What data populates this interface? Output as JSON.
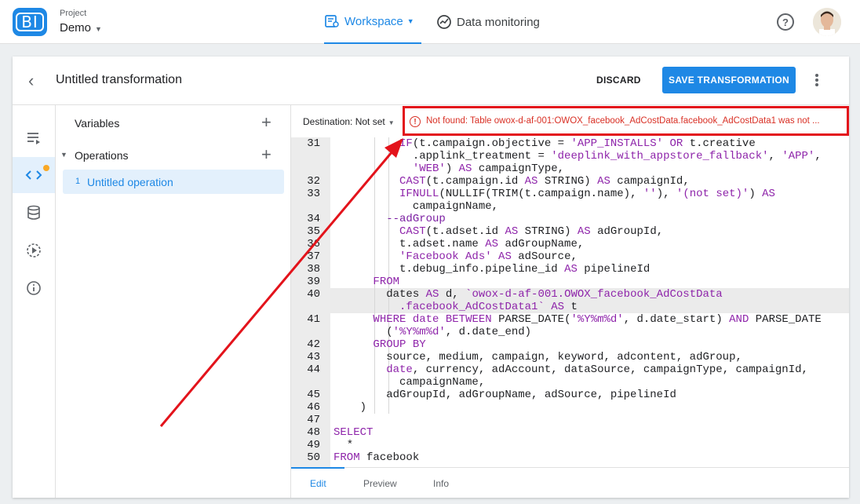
{
  "header": {
    "logo_text": "BI",
    "project_label": "Project",
    "project_name": "Demo",
    "nav": [
      {
        "label": "Workspace",
        "icon": "workspace-icon",
        "active": true
      },
      {
        "label": "Data monitoring",
        "icon": "monitoring-icon",
        "active": false
      }
    ],
    "help_icon": "?"
  },
  "card": {
    "back_icon": "‹",
    "title": "Untitled transformation",
    "discard_label": "DISCARD",
    "save_label": "SAVE TRANSFORMATION"
  },
  "panel": {
    "variables_label": "Variables",
    "operations_label": "Operations",
    "operation": {
      "num": "1",
      "name": "Untitled operation"
    }
  },
  "editor": {
    "destination": "Destination: Not set",
    "error": "Not found: Table owox-d-af-001:OWOX_facebook_AdCostData.facebook_AdCostData1 was not ...",
    "tabs": [
      "Edit",
      "Preview",
      "Info"
    ]
  },
  "code_lines": [
    {
      "n": "31",
      "html": "          <span class='kw'>IF</span>(t.campaign.objective = <span class='str'>'APP_INSTALLS'</span> <span class='kw'>OR</span> t.creative"
    },
    {
      "n": "",
      "html": "            .applink_treatment = <span class='str'>'deeplink_with_appstore_fallback'</span>, <span class='str'>'APP'</span>,"
    },
    {
      "n": "",
      "html": "            <span class='str'>'WEB'</span>) <span class='kw'>AS</span> campaignType,"
    },
    {
      "n": "32",
      "html": "          <span class='kw'>CAST</span>(t.campaign.id <span class='kw'>AS</span> STRING) <span class='kw'>AS</span> campaignId,"
    },
    {
      "n": "33",
      "html": "          <span class='kw'>IFNULL</span>(NULLIF(TRIM(t.campaign.name), <span class='str'>''</span>), <span class='str'>'(not set)'</span>) <span class='kw'>AS</span>"
    },
    {
      "n": "",
      "html": "            campaignName,"
    },
    {
      "n": "34",
      "html": "        <span class='cm'>--adGroup</span>"
    },
    {
      "n": "35",
      "html": "          <span class='kw'>CAST</span>(t.adset.id <span class='kw'>AS</span> STRING) <span class='kw'>AS</span> adGroupId,"
    },
    {
      "n": "36",
      "html": "          t.adset.name <span class='kw'>AS</span> adGroupName,"
    },
    {
      "n": "37",
      "html": "          <span class='str'>'Facebook Ads'</span> <span class='kw'>AS</span> adSource,"
    },
    {
      "n": "38",
      "html": "          t.debug_info.pipeline_id <span class='kw'>AS</span> pipelineId"
    },
    {
      "n": "39",
      "html": "      <span class='kw'>FROM</span>"
    },
    {
      "n": "40",
      "html": "        dates <span class='kw'>AS</span> d, <span class='str'>`owox-d-af-001.OWOX_facebook_AdCostData</span>"
    },
    {
      "n": "",
      "html": "          <span class='str'>.facebook_AdCostData1`</span> <span class='kw'>AS</span> t"
    },
    {
      "n": "41",
      "html": "      <span class='kw'>WHERE</span> <span class='kw'>date</span> <span class='kw'>BETWEEN</span> PARSE_DATE(<span class='str'>'%Y%m%d'</span>, d.date_start) <span class='kw'>AND</span> PARSE_DATE"
    },
    {
      "n": "",
      "html": "        (<span class='str'>'%Y%m%d'</span>, d.date_end)"
    },
    {
      "n": "42",
      "html": "      <span class='kw'>GROUP BY</span>"
    },
    {
      "n": "43",
      "html": "        source, medium, campaign, keyword, adcontent, adGroup,"
    },
    {
      "n": "44",
      "html": "        <span class='kw'>date</span>, currency, adAccount, dataSource, campaignType, campaignId,"
    },
    {
      "n": "",
      "html": "          campaignName,"
    },
    {
      "n": "45",
      "html": "        adGroupId, adGroupName, adSource, pipelineId"
    },
    {
      "n": "46",
      "html": "    )"
    },
    {
      "n": "47",
      "html": ""
    },
    {
      "n": "48",
      "html": "<span class='kw'>SELECT</span>"
    },
    {
      "n": "49",
      "html": "  *"
    },
    {
      "n": "50",
      "html": "<span class='kw'>FROM</span> facebook"
    }
  ],
  "colors": {
    "accent": "#1e88e5",
    "error": "#d93025",
    "annotation": "#e3131b",
    "keyword": "#8e24aa"
  }
}
